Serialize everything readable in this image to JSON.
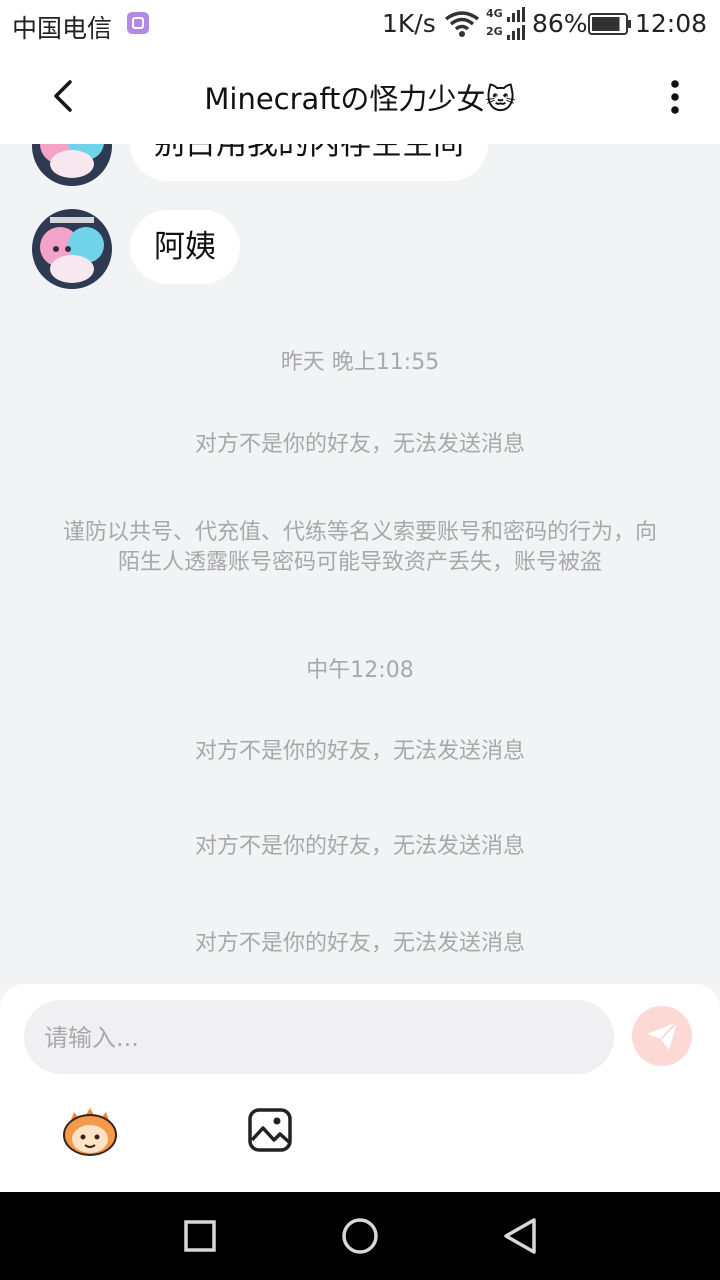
{
  "status_bar": {
    "carrier": "中国电信",
    "net_speed": "1K/s",
    "signal_types": [
      "4G",
      "2G"
    ],
    "battery_percent": "86%",
    "battery_level": 0.86,
    "time": "12:08"
  },
  "top_bar": {
    "title": "Minecraftの怪力少女🐱",
    "back_icon": "chevron-left-icon",
    "more_icon": "more-vertical-icon"
  },
  "messages": [
    {
      "type": "received",
      "text": "别占用我的内存空空间"
    },
    {
      "type": "received",
      "text": "阿姨"
    }
  ],
  "system": {
    "timestamp_1": "昨天 晚上11:55",
    "notice_1": "对方不是你的好友，无法发送消息",
    "warning": "谨防以共号、代充值、代练等名义索要账号和密码的行为，向陌生人透露账号密码可能导致资产丢失，账号被盗",
    "timestamp_2": "中午12:08",
    "notice_2": "对方不是你的好友，无法发送消息",
    "notice_3": "对方不是你的好友，无法发送消息",
    "notice_4": "对方不是你的好友，无法发送消息"
  },
  "input": {
    "placeholder": "请输入...",
    "value": "",
    "send_icon": "send-icon",
    "emoji_icon": "emoji-mascot-icon",
    "image_icon": "image-icon"
  },
  "nav_bar": {
    "icons": [
      "recent-apps-icon",
      "home-icon",
      "back-triangle-icon"
    ]
  },
  "colors": {
    "background": "#f2f3f5",
    "bubble": "#ffffff",
    "system_text": "#a8a8ab",
    "send_button": "#fdd9d6",
    "send_icon": "#ffffff",
    "app_icon": "#b28ae6"
  }
}
